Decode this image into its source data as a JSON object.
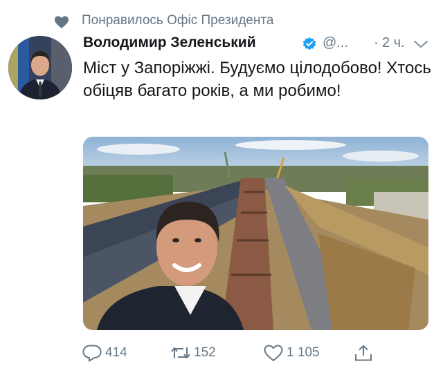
{
  "social_context": {
    "text": "Понравилось Офіс Президента",
    "icon": "heart-icon"
  },
  "author": {
    "name": "Володимир Зеленський",
    "verified": true,
    "handle": "@...",
    "dot": "·",
    "time": "2 ч."
  },
  "tweet": {
    "text": "Міст у Запоріжжі. Будуємо цілодобово! Хтось обіцяв багато років, а ми робимо!"
  },
  "media": {
    "description_icon": "photo"
  },
  "actions": {
    "reply_count": "414",
    "retweet_count": "152",
    "like_count": "1 105"
  },
  "colors": {
    "secondary_text": "#657786",
    "verified": "#1da1f2",
    "primary_text": "#14171a"
  }
}
